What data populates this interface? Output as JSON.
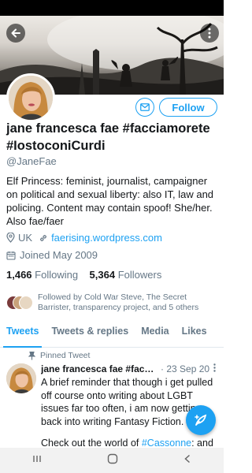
{
  "profile": {
    "name": "jane francesca fae #facciamorete #IostoconiCurdi",
    "handle": "@JaneFae",
    "bio": "Elf Princess: feminist, journalist, campaigner on political and sexual liberty: also IT,  law and policing. Content may contain spoof!  She/her. Also fae/faer",
    "location": "UK",
    "website": "faerising.wordpress.com",
    "joined": "Joined May 2009",
    "following_count": "1,466",
    "following_label": "Following",
    "followers_count": "5,364",
    "followers_label": "Followers",
    "followed_by": "Followed by Cold War Steve, The Secret Barrister, transparency project, and 5 others"
  },
  "actions": {
    "follow_label": "Follow"
  },
  "tabs": [
    {
      "label": "Tweets",
      "active": true
    },
    {
      "label": "Tweets & replies",
      "active": false
    },
    {
      "label": "Media",
      "active": false
    },
    {
      "label": "Likes",
      "active": false
    }
  ],
  "pinned_tweet": {
    "pinned_label": "Pinned Tweet",
    "author": "jane francesca fae #facciamorete #IostoconiCurdi",
    "date": "· 23 Sep 20",
    "text": "A brief reminder that though i get pulled off course onto writing about LGBT issues far too often, i am now getting back into writing Fantasy Fiction.",
    "text2_prefix": "Check out the world of ",
    "text2_tag": "#Cassonne",
    "text2_suffix": ": and"
  },
  "icons": {
    "back": "arrow-left-icon",
    "more": "more-vertical-icon",
    "mail": "mail-icon",
    "location": "location-pin-icon",
    "link": "link-icon",
    "calendar": "calendar-icon",
    "pin": "pin-icon",
    "compose": "compose-tweet-icon"
  },
  "colors": {
    "accent": "#1da1f2",
    "text": "#14171a",
    "muted": "#657786"
  }
}
